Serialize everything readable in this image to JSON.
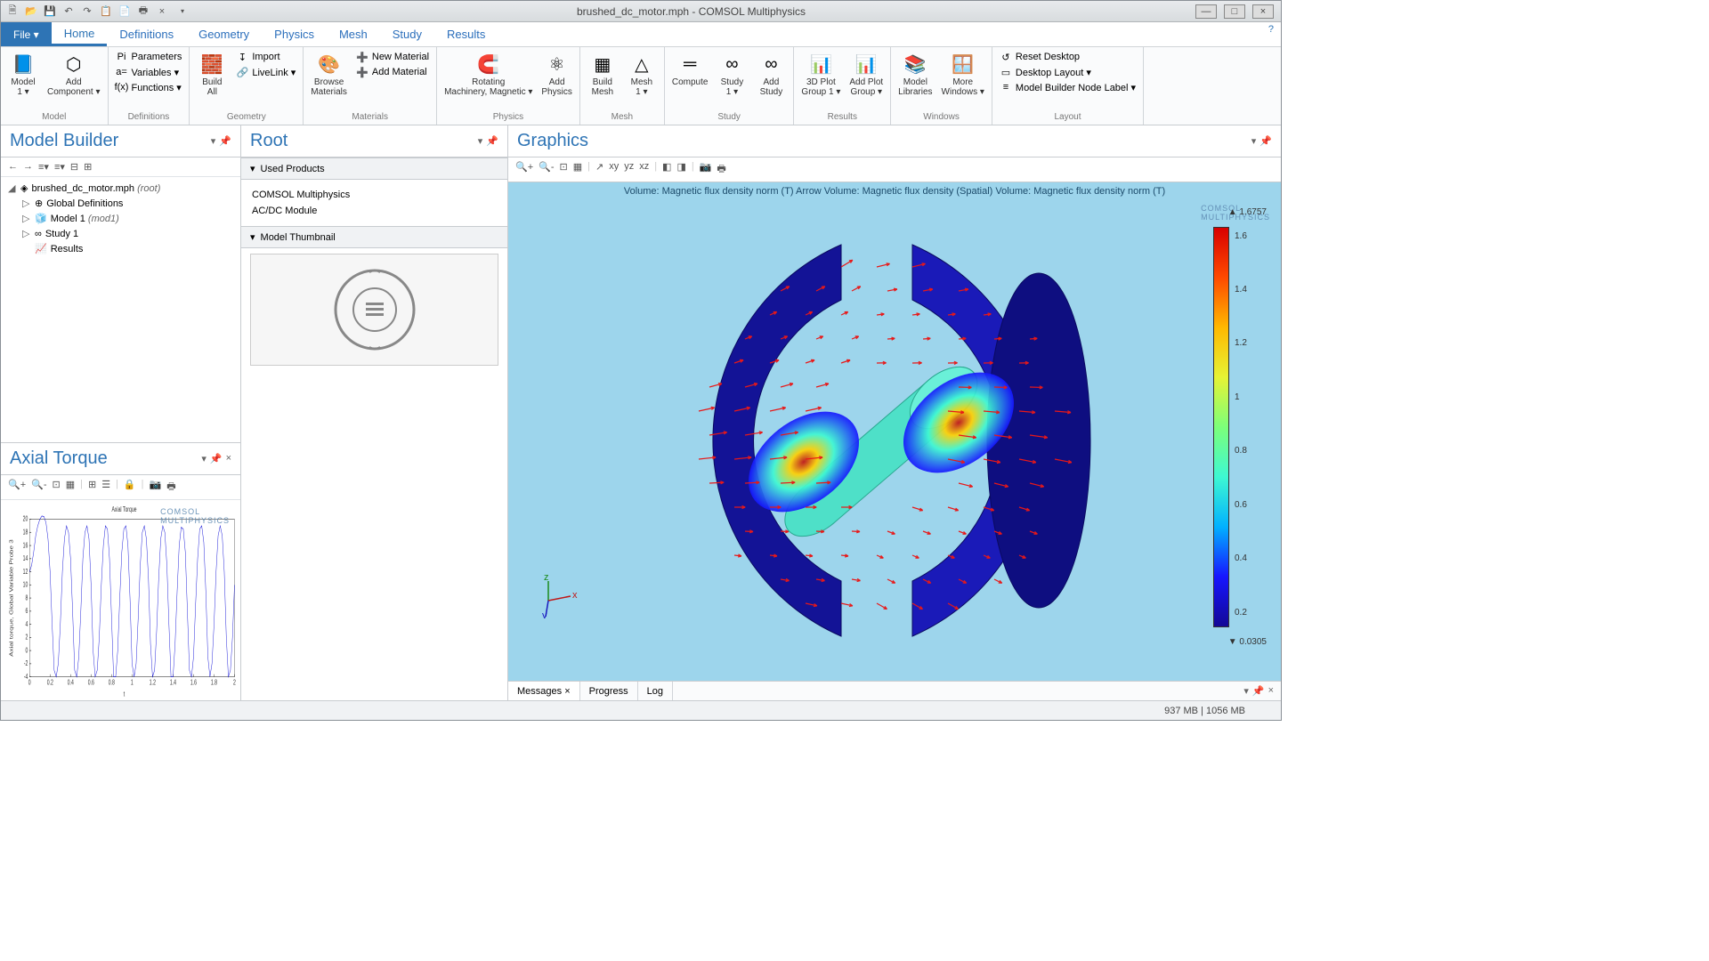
{
  "window": {
    "title": "brushed_dc_motor.mph - COMSOL Multiphysics"
  },
  "qat": [
    "new",
    "open",
    "save",
    "undo",
    "redo",
    "copy",
    "paste",
    "print",
    "delete"
  ],
  "win_btns": {
    "min": "—",
    "max": "□",
    "close": "×"
  },
  "tabs": [
    "Home",
    "Definitions",
    "Geometry",
    "Physics",
    "Mesh",
    "Study",
    "Results"
  ],
  "file_label": "File ▾",
  "ribbon_groups": [
    {
      "label": "Model",
      "big": [
        {
          "icon": "📘",
          "text": "Model\n1 ▾"
        },
        {
          "icon": "⬡",
          "text": "Add\nComponent ▾"
        }
      ]
    },
    {
      "label": "Definitions",
      "small": [
        [
          "Pi",
          "Parameters"
        ],
        [
          "a=",
          "Variables ▾"
        ],
        [
          "f(x)",
          "Functions ▾"
        ]
      ]
    },
    {
      "label": "Geometry",
      "big": [
        {
          "icon": "🧱",
          "text": "Build\nAll"
        }
      ],
      "small": [
        [
          "↧",
          "Import"
        ],
        [
          "🔗",
          "LiveLink ▾"
        ]
      ]
    },
    {
      "label": "Materials",
      "big": [
        {
          "icon": "🎨",
          "text": "Browse\nMaterials"
        }
      ],
      "small": [
        [
          "➕",
          "New Material"
        ],
        [
          "➕",
          "Add Material"
        ]
      ]
    },
    {
      "label": "Physics",
      "big": [
        {
          "icon": "🧲",
          "text": "Rotating\nMachinery, Magnetic ▾"
        },
        {
          "icon": "⚛",
          "text": "Add\nPhysics"
        }
      ]
    },
    {
      "label": "Mesh",
      "big": [
        {
          "icon": "▦",
          "text": "Build\nMesh"
        },
        {
          "icon": "△",
          "text": "Mesh\n1 ▾"
        }
      ]
    },
    {
      "label": "Study",
      "big": [
        {
          "icon": "═",
          "text": "Compute"
        },
        {
          "icon": "∞",
          "text": "Study\n1 ▾"
        },
        {
          "icon": "∞",
          "text": "Add\nStudy"
        }
      ]
    },
    {
      "label": "Results",
      "big": [
        {
          "icon": "📊",
          "text": "3D Plot\nGroup 1 ▾"
        },
        {
          "icon": "📊",
          "text": "Add Plot\nGroup ▾"
        }
      ]
    },
    {
      "label": "Windows",
      "big": [
        {
          "icon": "📚",
          "text": "Model\nLibraries"
        },
        {
          "icon": "🪟",
          "text": "More\nWindows ▾"
        }
      ]
    },
    {
      "label": "Layout",
      "small": [
        [
          "↺",
          "Reset Desktop"
        ],
        [
          "▭",
          "Desktop Layout ▾"
        ],
        [
          "≡",
          "Model Builder Node Label ▾"
        ]
      ]
    }
  ],
  "model_builder": {
    "title": "Model Builder",
    "tree": [
      {
        "exp": "◢",
        "icon": "◈",
        "label": "brushed_dc_motor.mph (root)",
        "italic": "(root)",
        "indent": 0
      },
      {
        "exp": "▷",
        "icon": "⊕",
        "label": "Global Definitions",
        "indent": 1
      },
      {
        "exp": "▷",
        "icon": "🧊",
        "label": "Model 1 (mod1)",
        "italic": "(mod1)",
        "indent": 1
      },
      {
        "exp": "▷",
        "icon": "∞",
        "label": "Study 1",
        "indent": 1
      },
      {
        "exp": "",
        "icon": "📈",
        "label": "Results",
        "indent": 1
      }
    ]
  },
  "root_panel": {
    "title": "Root",
    "sections": {
      "products": "Used Products",
      "thumb": "Model Thumbnail"
    },
    "products": [
      "COMSOL Multiphysics",
      "AC/DC Module"
    ]
  },
  "graphics": {
    "title": "Graphics",
    "caption": "Volume: Magnetic flux density norm (T)   Arrow Volume: Magnetic flux density (Spatial)   Volume: Magnetic flux density norm (T)",
    "max": "▲ 1.6757",
    "min": "▼ 0.0305",
    "ticks": [
      "1.6",
      "1.4",
      "1.2",
      "1",
      "0.8",
      "0.6",
      "0.4",
      "0.2"
    ],
    "axes": {
      "x": "x",
      "y": "y",
      "z": "z"
    },
    "watermark": "COMSOL\nMULTIPHYSICS"
  },
  "bottom_tabs": [
    "Messages ×",
    "Progress",
    "Log"
  ],
  "status": "937 MB | 1056 MB",
  "axial": {
    "title": "Axial Torque",
    "chart_title": "Axial Torque",
    "ylabel": "Axial torque, Global Variable Probe 3",
    "xlabel": "t",
    "watermark": "COMSOL\nMULTIPHYSICS"
  },
  "chart_data": {
    "type": "line",
    "title": "Axial Torque",
    "xlabel": "t",
    "ylabel": "Axial torque, Global Variable Probe 3",
    "xlim": [
      0,
      2
    ],
    "ylim": [
      -4,
      20
    ],
    "xticks": [
      0,
      0.2,
      0.4,
      0.6,
      0.8,
      1,
      1.2,
      1.4,
      1.6,
      1.8,
      2
    ],
    "yticks": [
      -4,
      -2,
      0,
      2,
      4,
      6,
      8,
      10,
      12,
      14,
      16,
      18,
      20
    ],
    "x": [
      0,
      0.02,
      0.04,
      0.06,
      0.08,
      0.1,
      0.12,
      0.14,
      0.16,
      0.18,
      0.2,
      0.22,
      0.24,
      0.26,
      0.28,
      0.3,
      0.32,
      0.34,
      0.36,
      0.38,
      0.4,
      0.42,
      0.44,
      0.46,
      0.48,
      0.5,
      0.52,
      0.54,
      0.56,
      0.58,
      0.6,
      0.62,
      0.64,
      0.66,
      0.68,
      0.7,
      0.72,
      0.74,
      0.76,
      0.78,
      0.8,
      0.82,
      0.84,
      0.86,
      0.88,
      0.9,
      0.92,
      0.94,
      0.96,
      0.98,
      1,
      1.02,
      1.04,
      1.06,
      1.08,
      1.1,
      1.12,
      1.14,
      1.16,
      1.18,
      1.2,
      1.22,
      1.24,
      1.26,
      1.28,
      1.3,
      1.32,
      1.34,
      1.36,
      1.38,
      1.4,
      1.42,
      1.44,
      1.46,
      1.48,
      1.5,
      1.52,
      1.54,
      1.56,
      1.58,
      1.6,
      1.62,
      1.64,
      1.66,
      1.68,
      1.7,
      1.72,
      1.74,
      1.76,
      1.78,
      1.8,
      1.82,
      1.84,
      1.86,
      1.88,
      1.9,
      1.92,
      1.94,
      1.96,
      1.98,
      2
    ],
    "y": [
      12,
      13,
      15,
      17.5,
      19,
      20,
      20.5,
      20.4,
      19.5,
      17,
      12,
      4,
      -3,
      -4,
      -2,
      4,
      12,
      17,
      19,
      18,
      14,
      6,
      -3,
      -4,
      -1,
      6,
      14,
      18,
      19,
      17,
      10,
      0,
      -4,
      -3,
      2,
      10,
      16,
      19,
      18.5,
      14,
      5,
      -4,
      -4,
      0,
      8,
      15,
      18.5,
      19,
      16,
      8,
      -2,
      -4,
      -2,
      5,
      13,
      18,
      19,
      17,
      11,
      1,
      -4,
      -3,
      3,
      11,
      17,
      19,
      18,
      13,
      4,
      -4,
      -4,
      1,
      9,
      16,
      18.8,
      18.5,
      15,
      6,
      -3,
      -4,
      -1,
      7,
      14,
      18.5,
      19,
      16.5,
      9,
      -1,
      -4,
      -2,
      4,
      12,
      17.5,
      19,
      17.5,
      12,
      2,
      -4,
      -3,
      2,
      10
    ]
  }
}
